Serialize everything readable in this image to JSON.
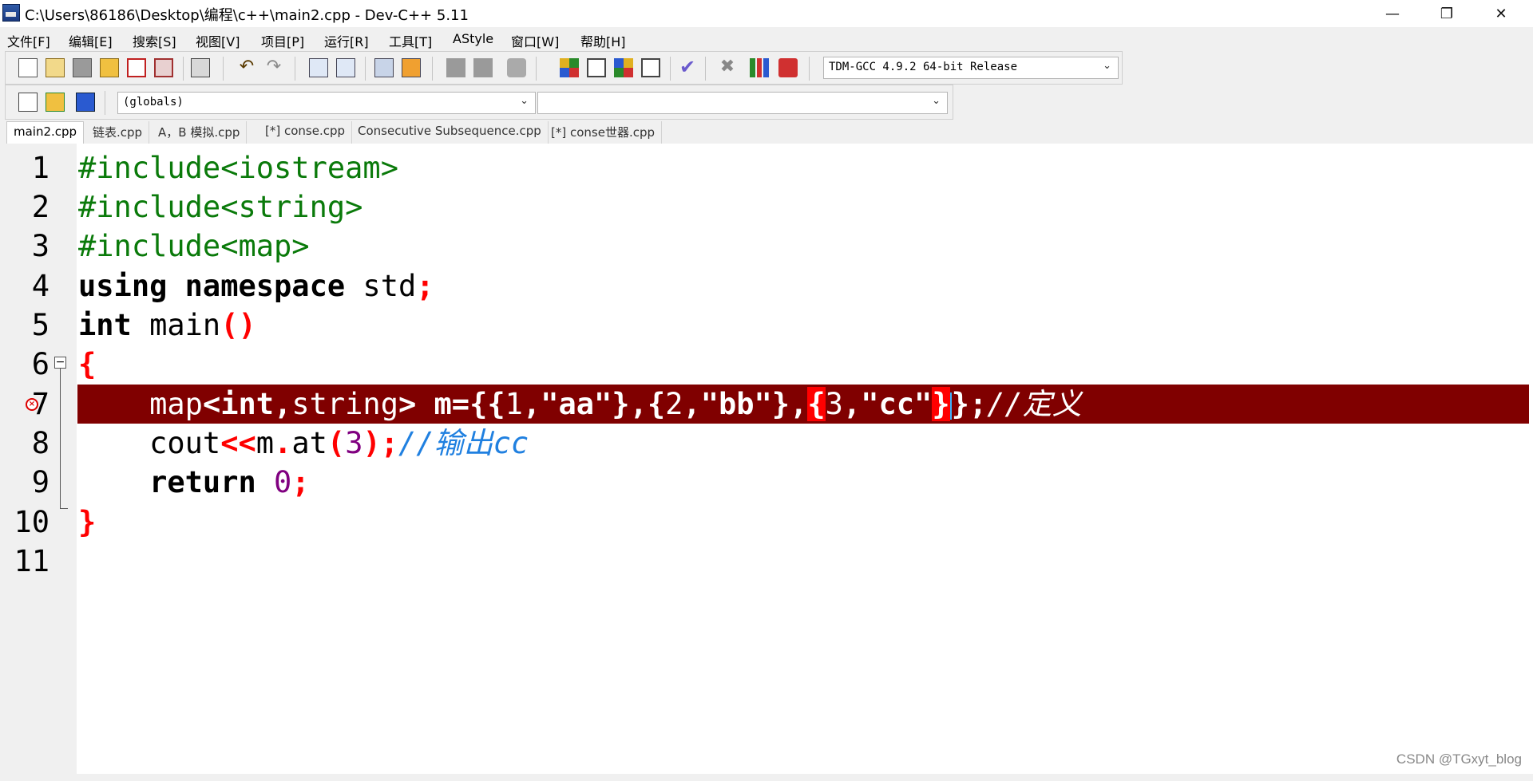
{
  "window": {
    "title": "C:\\Users\\86186\\Desktop\\编程\\c++\\main2.cpp - Dev-C++ 5.11",
    "minimize_glyph": "—",
    "restore_glyph": "❐",
    "close_glyph": "✕"
  },
  "menu": [
    "文件[F]",
    "编辑[E]",
    "搜索[S]",
    "视图[V]",
    "项目[P]",
    "运行[R]",
    "工具[T]",
    "AStyle",
    "窗口[W]",
    "帮助[H]"
  ],
  "toolbar": {
    "compiler_select": "TDM-GCC 4.9.2 64-bit Release",
    "scope_select": "(globals)",
    "function_select": ""
  },
  "tabs": [
    "main2.cpp",
    "链表.cpp",
    "A，B 模拟.cpp",
    "[*] conse.cpp",
    "Consecutive Subsequence.cpp",
    "[*] conse世器.cpp"
  ],
  "active_tab": 0,
  "line_numbers": [
    "1",
    "2",
    "3",
    "4",
    "5",
    "6",
    "7",
    "8",
    "9",
    "10",
    "11"
  ],
  "code": {
    "l1": "#include<iostream>",
    "l2": "#include<string>",
    "l3": "#include<map>",
    "l4_kw": "using namespace",
    "l4_rest": " std",
    "l4_semi": ";",
    "l5_kw": "int",
    "l5_rest": " main",
    "l5_paren": "()",
    "l6": "{",
    "l7_a": "    map",
    "l7_b": "<int,",
    "l7_c": "string",
    "l7_d": "> m={{",
    "l7_e": "1",
    "l7_f": ",\"aa\"},{",
    "l7_g": "2",
    "l7_h": ",\"bb\"},",
    "l7_i": "{",
    "l7_j": "3",
    "l7_k": ",\"cc\"",
    "l7_l": "}",
    "l7_m": "};",
    "l7_cmt": "//定义",
    "l8_a": "    cout",
    "l8_b": "<<",
    "l8_c": "m",
    "l8_d": ".",
    "l8_e": "at",
    "l8_f": "(",
    "l8_g": "3",
    "l8_h": ");",
    "l8_cmt": "//输出cc",
    "l9_kw": "    return",
    "l9_num": " 0",
    "l9_semi": ";",
    "l10": "}",
    "l11": ""
  },
  "error_line": 7,
  "watermark": "CSDN @TGxyt_blog",
  "colors": {
    "error_line_bg": "#800000",
    "preprocessor": "#0a7a0a",
    "symbol": "#ff0000",
    "number": "#800080",
    "comment": "#2080e0"
  }
}
